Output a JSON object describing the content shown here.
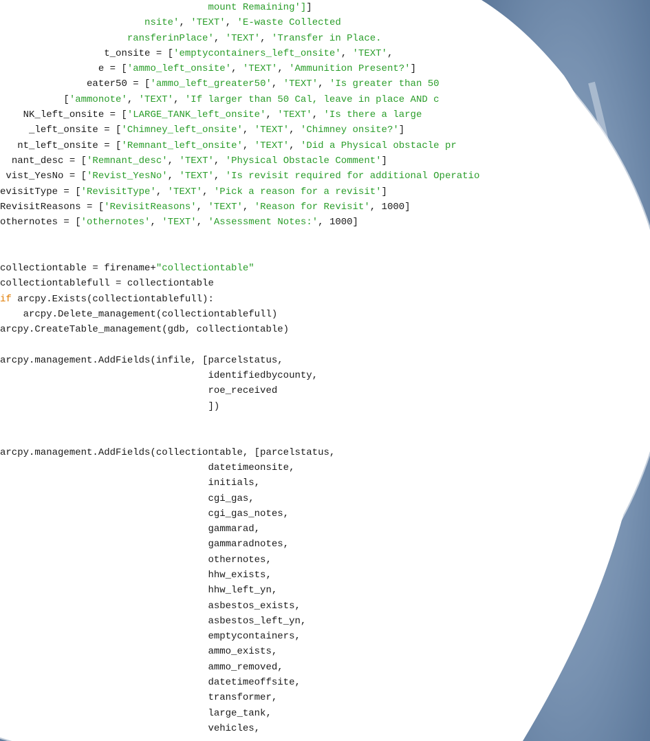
{
  "colors": {
    "frame_blue": "#5f7fa3",
    "frame_light": "#c7d2de",
    "string_green": "#2a9d2a",
    "keyword_orange": "#e07b00",
    "code_text": "#1a1a1a",
    "background": "#ffffff"
  },
  "code": {
    "lines": [
      {
        "segments": [
          {
            "t": "                                    "
          },
          {
            "t": "mount Remaining']",
            "c": "str"
          },
          {
            "t": "]"
          }
        ]
      },
      {
        "segments": [
          {
            "t": "                         "
          },
          {
            "t": "nsite'",
            "c": "str"
          },
          {
            "t": ", "
          },
          {
            "t": "'TEXT'",
            "c": "str"
          },
          {
            "t": ", "
          },
          {
            "t": "'E-waste Collected",
            "c": "str"
          }
        ]
      },
      {
        "segments": [
          {
            "t": "                      "
          },
          {
            "t": "ransferinPlace'",
            "c": "str"
          },
          {
            "t": ", "
          },
          {
            "t": "'TEXT'",
            "c": "str"
          },
          {
            "t": ", "
          },
          {
            "t": "'Transfer in Place.",
            "c": "str"
          }
        ]
      },
      {
        "segments": [
          {
            "t": "                  "
          },
          {
            "t": "t_onsite = ["
          },
          {
            "t": "'emptycontainers_left_onsite'",
            "c": "str"
          },
          {
            "t": ", "
          },
          {
            "t": "'TEXT'",
            "c": "str"
          },
          {
            "t": ","
          }
        ]
      },
      {
        "segments": [
          {
            "t": "                 "
          },
          {
            "t": "e = ["
          },
          {
            "t": "'ammo_left_onsite'",
            "c": "str"
          },
          {
            "t": ", "
          },
          {
            "t": "'TEXT'",
            "c": "str"
          },
          {
            "t": ", "
          },
          {
            "t": "'Ammunition Present?'",
            "c": "str"
          },
          {
            "t": "]"
          }
        ]
      },
      {
        "segments": [
          {
            "t": "               "
          },
          {
            "t": "eater50 = ["
          },
          {
            "t": "'ammo_left_greater50'",
            "c": "str"
          },
          {
            "t": ", "
          },
          {
            "t": "'TEXT'",
            "c": "str"
          },
          {
            "t": ", "
          },
          {
            "t": "'Is greater than 50",
            "c": "str"
          }
        ]
      },
      {
        "segments": [
          {
            "t": "           "
          },
          {
            "t": "["
          },
          {
            "t": "'ammonote'",
            "c": "str"
          },
          {
            "t": ", "
          },
          {
            "t": "'TEXT'",
            "c": "str"
          },
          {
            "t": ", "
          },
          {
            "t": "'If larger than 50 Cal, leave in place AND c",
            "c": "str"
          }
        ]
      },
      {
        "segments": [
          {
            "t": "    "
          },
          {
            "t": "NK_left_onsite = ["
          },
          {
            "t": "'LARGE_TANK_left_onsite'",
            "c": "str"
          },
          {
            "t": ", "
          },
          {
            "t": "'TEXT'",
            "c": "str"
          },
          {
            "t": ", "
          },
          {
            "t": "'Is there a large",
            "c": "str"
          }
        ]
      },
      {
        "segments": [
          {
            "t": "     "
          },
          {
            "t": "_left_onsite = ["
          },
          {
            "t": "'Chimney_left_onsite'",
            "c": "str"
          },
          {
            "t": ", "
          },
          {
            "t": "'TEXT'",
            "c": "str"
          },
          {
            "t": ", "
          },
          {
            "t": "'Chimney onsite?'",
            "c": "str"
          },
          {
            "t": "]"
          }
        ]
      },
      {
        "segments": [
          {
            "t": "   "
          },
          {
            "t": "nt_left_onsite = ["
          },
          {
            "t": "'Remnant_left_onsite'",
            "c": "str"
          },
          {
            "t": ", "
          },
          {
            "t": "'TEXT'",
            "c": "str"
          },
          {
            "t": ", "
          },
          {
            "t": "'Did a Physical obstacle pr",
            "c": "str"
          }
        ]
      },
      {
        "segments": [
          {
            "t": "  "
          },
          {
            "t": "nant_desc = ["
          },
          {
            "t": "'Remnant_desc'",
            "c": "str"
          },
          {
            "t": ", "
          },
          {
            "t": "'TEXT'",
            "c": "str"
          },
          {
            "t": ", "
          },
          {
            "t": "'Physical Obstacle Comment'",
            "c": "str"
          },
          {
            "t": "]"
          }
        ]
      },
      {
        "segments": [
          {
            "t": " "
          },
          {
            "t": "vist_YesNo = ["
          },
          {
            "t": "'Revist_YesNo'",
            "c": "str"
          },
          {
            "t": ", "
          },
          {
            "t": "'TEXT'",
            "c": "str"
          },
          {
            "t": ", "
          },
          {
            "t": "'Is revisit required for additional Operatio",
            "c": "str"
          }
        ]
      },
      {
        "segments": [
          {
            "t": "evisitType = ["
          },
          {
            "t": "'RevisitType'",
            "c": "str"
          },
          {
            "t": ", "
          },
          {
            "t": "'TEXT'",
            "c": "str"
          },
          {
            "t": ", "
          },
          {
            "t": "'Pick a reason for a revisit'",
            "c": "str"
          },
          {
            "t": "]"
          }
        ]
      },
      {
        "segments": [
          {
            "t": "RevisitReasons = ["
          },
          {
            "t": "'RevisitReasons'",
            "c": "str"
          },
          {
            "t": ", "
          },
          {
            "t": "'TEXT'",
            "c": "str"
          },
          {
            "t": ", "
          },
          {
            "t": "'Reason for Revisit'",
            "c": "str"
          },
          {
            "t": ", 1000]"
          }
        ]
      },
      {
        "segments": [
          {
            "t": "othernotes = ["
          },
          {
            "t": "'othernotes'",
            "c": "str"
          },
          {
            "t": ", "
          },
          {
            "t": "'TEXT'",
            "c": "str"
          },
          {
            "t": ", "
          },
          {
            "t": "'Assessment Notes:'",
            "c": "str"
          },
          {
            "t": ", 1000]"
          }
        ]
      },
      {
        "segments": [
          {
            "t": ""
          }
        ]
      },
      {
        "segments": [
          {
            "t": ""
          }
        ]
      },
      {
        "segments": [
          {
            "t": "collectiontable = firename+"
          },
          {
            "t": "\"collectiontable\"",
            "c": "str"
          }
        ]
      },
      {
        "segments": [
          {
            "t": "collectiontablefull = collectiontable"
          }
        ]
      },
      {
        "segments": [
          {
            "t": "if",
            "c": "kw"
          },
          {
            "t": " arcpy.Exists(collectiontablefull):"
          }
        ]
      },
      {
        "segments": [
          {
            "t": "    arcpy.Delete_management(collectiontablefull)"
          }
        ]
      },
      {
        "segments": [
          {
            "t": "arcpy.CreateTable_management(gdb, collectiontable)"
          }
        ]
      },
      {
        "segments": [
          {
            "t": ""
          }
        ]
      },
      {
        "segments": [
          {
            "t": "arcpy.management.AddFields(infile, [parcelstatus,"
          }
        ]
      },
      {
        "segments": [
          {
            "t": "                                    identifiedbycounty,"
          }
        ]
      },
      {
        "segments": [
          {
            "t": "                                    roe_received"
          }
        ]
      },
      {
        "segments": [
          {
            "t": "                                    ])"
          }
        ]
      },
      {
        "segments": [
          {
            "t": ""
          }
        ]
      },
      {
        "segments": [
          {
            "t": ""
          }
        ]
      },
      {
        "segments": [
          {
            "t": "arcpy.management.AddFields(collectiontable, [parcelstatus,"
          }
        ]
      },
      {
        "segments": [
          {
            "t": "                                    datetimeonsite,"
          }
        ]
      },
      {
        "segments": [
          {
            "t": "                                    initials,"
          }
        ]
      },
      {
        "segments": [
          {
            "t": "                                    cgi_gas,"
          }
        ]
      },
      {
        "segments": [
          {
            "t": "                                    cgi_gas_notes,"
          }
        ]
      },
      {
        "segments": [
          {
            "t": "                                    gammarad,"
          }
        ]
      },
      {
        "segments": [
          {
            "t": "                                    gammaradnotes,"
          }
        ]
      },
      {
        "segments": [
          {
            "t": "                                    othernotes,"
          }
        ]
      },
      {
        "segments": [
          {
            "t": "                                    hhw_exists,"
          }
        ]
      },
      {
        "segments": [
          {
            "t": "                                    hhw_left_yn,"
          }
        ]
      },
      {
        "segments": [
          {
            "t": "                                    asbestos_exists,"
          }
        ]
      },
      {
        "segments": [
          {
            "t": "                                    asbestos_left_yn,"
          }
        ]
      },
      {
        "segments": [
          {
            "t": "                                    emptycontainers,"
          }
        ]
      },
      {
        "segments": [
          {
            "t": "                                    ammo_exists,"
          }
        ]
      },
      {
        "segments": [
          {
            "t": "                                    ammo_removed,"
          }
        ]
      },
      {
        "segments": [
          {
            "t": "                                    datetimeoffsite,"
          }
        ]
      },
      {
        "segments": [
          {
            "t": "                                    transformer,"
          }
        ]
      },
      {
        "segments": [
          {
            "t": "                                    large_tank,"
          }
        ]
      },
      {
        "segments": [
          {
            "t": "                                    vehicles,"
          }
        ]
      }
    ]
  }
}
